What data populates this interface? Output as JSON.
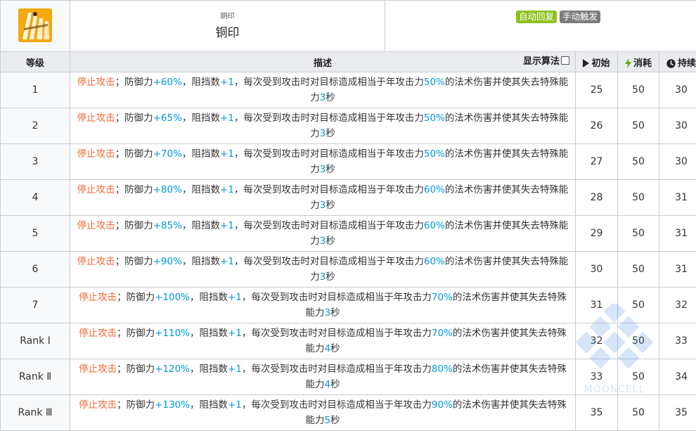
{
  "skill": {
    "icon": "tanker-pillar-icon",
    "name_small": "銅印",
    "name": "铜印",
    "tags": [
      "自动回复",
      "手动触发"
    ],
    "tag_colors": {
      "auto": "#8cc21f",
      "manual": "#7c7c7c"
    }
  },
  "headers": {
    "level": "等级",
    "desc": "描述",
    "algo_toggle": "显示算法",
    "initial": "初始",
    "cost": "消耗",
    "duration": "持续"
  },
  "colors": {
    "keyword": "#f06a36",
    "number": "#0098dc",
    "cost_icon": "#5ab000"
  },
  "levels": [
    {
      "level": "1",
      "keyword": "停止攻击",
      "def": "+60%",
      "block": "+1",
      "dmg": "50%",
      "dur_text": "3",
      "lead": "；防御力",
      "mid1": "，阻挡数",
      "mid2": "，每次受到攻击时对目标造成相当于年攻击力",
      "mid3": "的法术伤害并使其失去特殊能力",
      "tail": "秒",
      "initial": "25",
      "cost": "50",
      "duration": "30"
    },
    {
      "level": "2",
      "keyword": "停止攻击",
      "def": "+65%",
      "block": "+1",
      "dmg": "50%",
      "dur_text": "3",
      "lead": "；防御力",
      "mid1": "，阻挡数",
      "mid2": "，每次受到攻击时对目标造成相当于年攻击力",
      "mid3": "的法术伤害并使其失去特殊能力",
      "tail": "秒",
      "initial": "26",
      "cost": "50",
      "duration": "30"
    },
    {
      "level": "3",
      "keyword": "停止攻击",
      "def": "+70%",
      "block": "+1",
      "dmg": "50%",
      "dur_text": "3",
      "lead": "；防御力",
      "mid1": "，阻挡数",
      "mid2": "，每次受到攻击时对目标造成相当于年攻击力",
      "mid3": "的法术伤害并使其失去特殊能力",
      "tail": "秒",
      "initial": "27",
      "cost": "50",
      "duration": "30"
    },
    {
      "level": "4",
      "keyword": "停止攻击",
      "def": "+80%",
      "block": "+1",
      "dmg": "60%",
      "dur_text": "3",
      "lead": "；防御力",
      "mid1": "，阻挡数",
      "mid2": "，每次受到攻击时对目标造成相当于年攻击力",
      "mid3": "的法术伤害并使其失去特殊能力",
      "tail": "秒",
      "initial": "28",
      "cost": "50",
      "duration": "31"
    },
    {
      "level": "5",
      "keyword": "停止攻击",
      "def": "+85%",
      "block": "+1",
      "dmg": "60%",
      "dur_text": "3",
      "lead": "；防御力",
      "mid1": "，阻挡数",
      "mid2": "，每次受到攻击时对目标造成相当于年攻击力",
      "mid3": "的法术伤害并使其失去特殊能力",
      "tail": "秒",
      "initial": "29",
      "cost": "50",
      "duration": "31"
    },
    {
      "level": "6",
      "keyword": "停止攻击",
      "def": "+90%",
      "block": "+1",
      "dmg": "60%",
      "dur_text": "3",
      "lead": "；防御力",
      "mid1": "，阻挡数",
      "mid2": "，每次受到攻击时对目标造成相当于年攻击力",
      "mid3": "的法术伤害并使其失去特殊能力",
      "tail": "秒",
      "initial": "30",
      "cost": "50",
      "duration": "31"
    },
    {
      "level": "7",
      "keyword": "停止攻击",
      "def": "+100%",
      "block": "+1",
      "dmg": "70%",
      "dur_text": "3",
      "lead": "；防御力",
      "mid1": "，阻挡数",
      "mid2": "，每次受到攻击时对目标造成相当于年攻击力",
      "mid3": "的法术伤害并使其失去特殊能力",
      "tail": "秒",
      "initial": "31",
      "cost": "50",
      "duration": "32"
    },
    {
      "level": "Rank Ⅰ",
      "keyword": "停止攻击",
      "def": "+110%",
      "block": "+1",
      "dmg": "70%",
      "dur_text": "4",
      "lead": "；防御力",
      "mid1": "，阻挡数",
      "mid2": "，每次受到攻击时对目标造成相当于年攻击力",
      "mid3": "的法术伤害并使其失去特殊能力",
      "tail": "秒",
      "initial": "32",
      "cost": "50",
      "duration": "33"
    },
    {
      "level": "Rank Ⅱ",
      "keyword": "停止攻击",
      "def": "+120%",
      "block": "+1",
      "dmg": "80%",
      "dur_text": "4",
      "lead": "；防御力",
      "mid1": "，阻挡数",
      "mid2": "，每次受到攻击时对目标造成相当于年攻击力",
      "mid3": "的法术伤害并使其失去特殊能力",
      "tail": "秒",
      "initial": "33",
      "cost": "50",
      "duration": "34"
    },
    {
      "level": "Rank Ⅲ",
      "keyword": "停止攻击",
      "def": "+130%",
      "block": "+1",
      "dmg": "90%",
      "dur_text": "5",
      "lead": "；防御力",
      "mid1": "，阻挡数",
      "mid2": "，每次受到攻击时对目标造成相当于年攻击力",
      "mid3": "的法术伤害并使其失去特殊能力",
      "tail": "秒",
      "initial": "35",
      "cost": "50",
      "duration": "35"
    }
  ],
  "watermark": "MOONCELL"
}
